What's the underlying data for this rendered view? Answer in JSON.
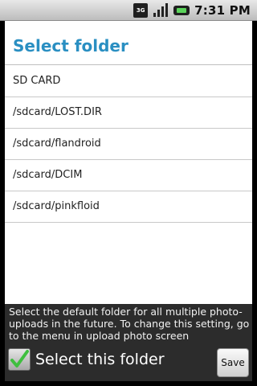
{
  "status_bar": {
    "network_label": "3G",
    "clock": "7:31 PM",
    "icons": [
      "3g-icon",
      "signal-icon",
      "battery-icon"
    ]
  },
  "dialog": {
    "title": "Select folder",
    "folders": [
      "SD CARD",
      "/sdcard/LOST.DIR",
      "/sdcard/flandroid",
      "/sdcard/DCIM",
      "/sdcard/pinkfloid"
    ],
    "hint": "Select the default folder for all multiple photo-uploads in the future. To change this setting, go to the menu in upload photo screen",
    "checkbox_label": "Select this folder",
    "checkbox_checked": true,
    "save_label": "Save"
  },
  "colors": {
    "title": "#2a8fc2",
    "check": "#3fbf3f",
    "bottom_bg": "#2c2c2c"
  }
}
